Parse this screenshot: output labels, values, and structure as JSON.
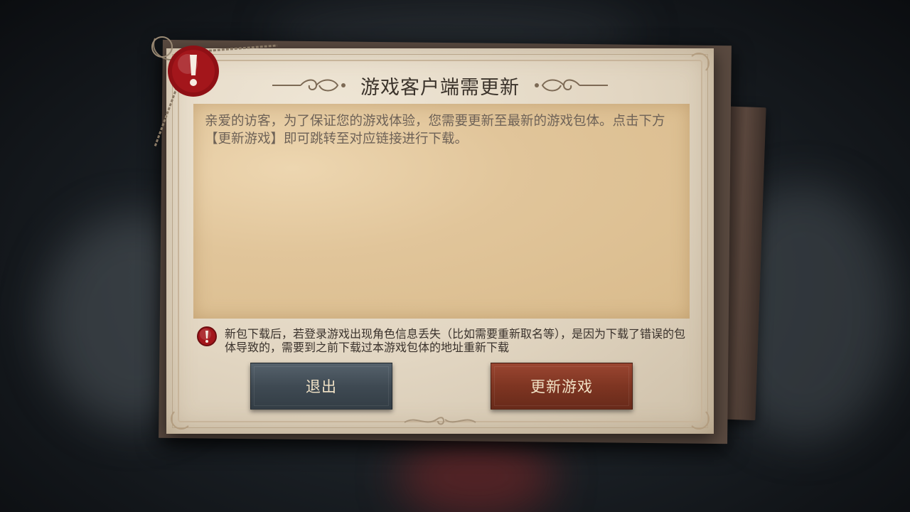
{
  "dialog": {
    "title": "游戏客户端需更新",
    "message": "亲爱的访客，为了保证您的游戏体验，您需要更新至最新的游戏包体。点击下方【更新游戏】即可跳转至对应链接进行下载。",
    "warning": "新包下载后，若登录游戏出现角色信息丢失（比如需要重新取名等），是因为下载了错误的包体导致的，需要到之前下载过本游戏包体的地址重新下载",
    "warning_icon": "exclamation-icon",
    "seal_icon": "wax-seal-exclamation-icon"
  },
  "buttons": {
    "exit_label": "退出",
    "update_label": "更新游戏"
  },
  "colors": {
    "seal_red": "#a3161b",
    "button_exit": "#46525b",
    "button_update": "#853825",
    "paper": "#e2d6c2",
    "content_box": "#e1c59a"
  }
}
